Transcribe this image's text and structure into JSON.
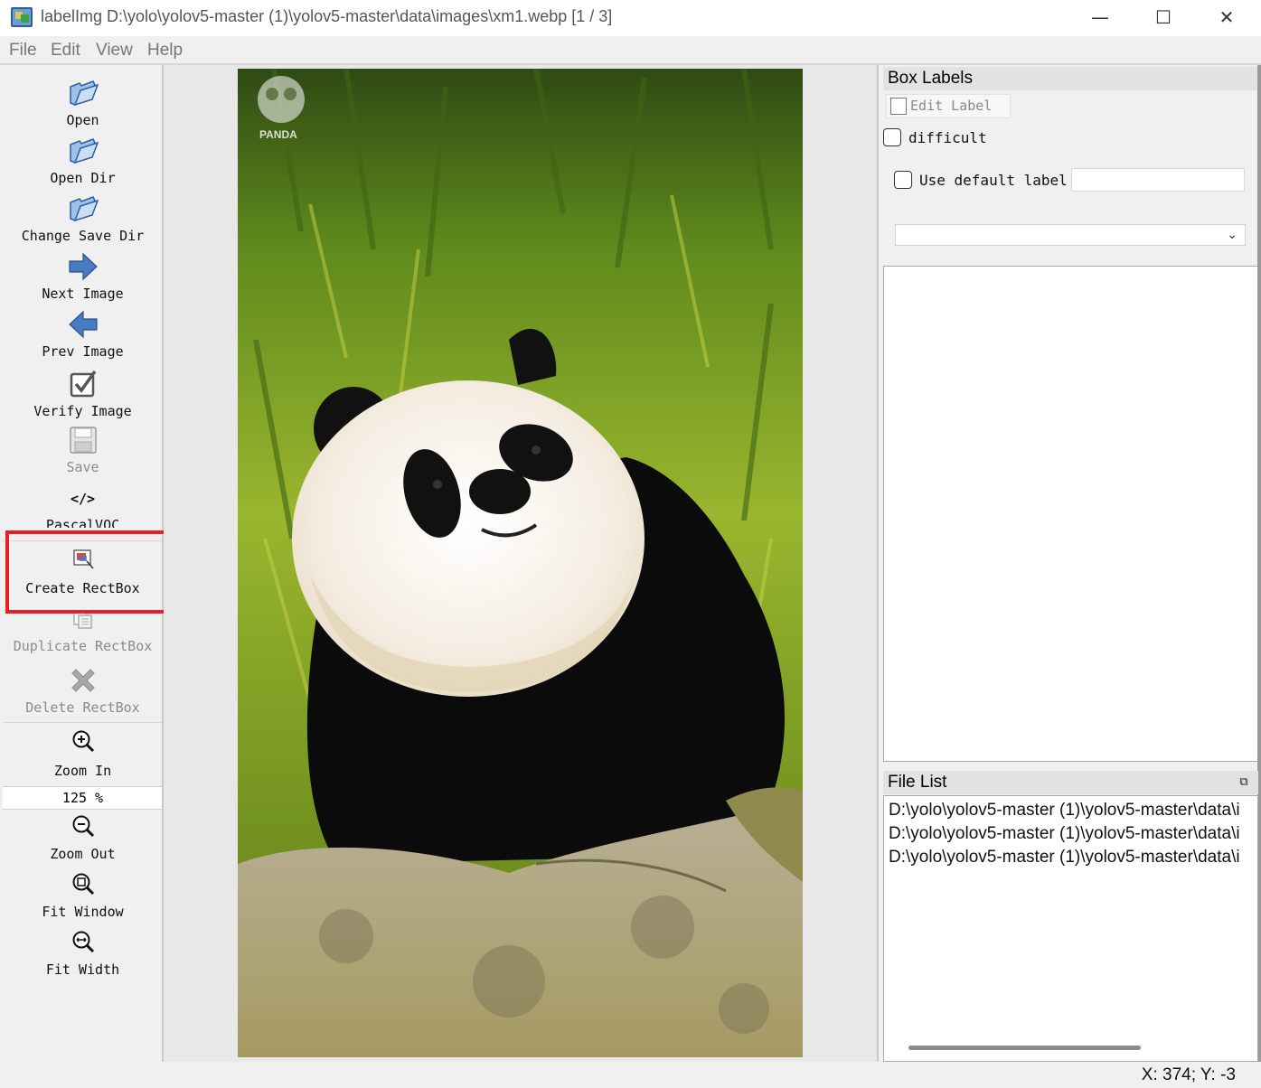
{
  "window": {
    "title": "labelImg D:\\yolo\\yolov5-master (1)\\yolov5-master\\data\\images\\xm1.webp [1 / 3]",
    "minimize_glyph": "—",
    "maximize_glyph": "☐",
    "close_glyph": "✕"
  },
  "menu": [
    "File",
    "Edit",
    "View",
    "Help"
  ],
  "toolbar": {
    "open": "Open",
    "open_dir": "Open Dir",
    "change_save_dir": "Change Save Dir",
    "next_image": "Next Image",
    "prev_image": "Prev Image",
    "verify_image": "Verify Image",
    "save": "Save",
    "format_icon_text": "</>",
    "format": "PascalVOC",
    "create_rectbox": "Create RectBox",
    "duplicate_rectbox": "Duplicate RectBox",
    "delete_rectbox": "Delete RectBox",
    "zoom_in": "Zoom In",
    "zoom_value": "125 %",
    "zoom_out": "Zoom Out",
    "fit_window": "Fit Window",
    "fit_width": "Fit Width"
  },
  "image": {
    "watermark": "PANDA"
  },
  "box_labels": {
    "header": "Box Labels",
    "edit_label": "Edit Label",
    "difficult": "difficult",
    "use_default_label": "Use default label",
    "default_label_value": "",
    "label_combo_value": ""
  },
  "file_list": {
    "header": "File List",
    "files": [
      "D:\\yolo\\yolov5-master (1)\\yolov5-master\\data\\i",
      "D:\\yolo\\yolov5-master (1)\\yolov5-master\\data\\i",
      "D:\\yolo\\yolov5-master (1)\\yolov5-master\\data\\i"
    ]
  },
  "status": "X: 374; Y: -3",
  "colors": {
    "highlight": "#e81f25",
    "icon_blue": "#4a7cc2"
  }
}
